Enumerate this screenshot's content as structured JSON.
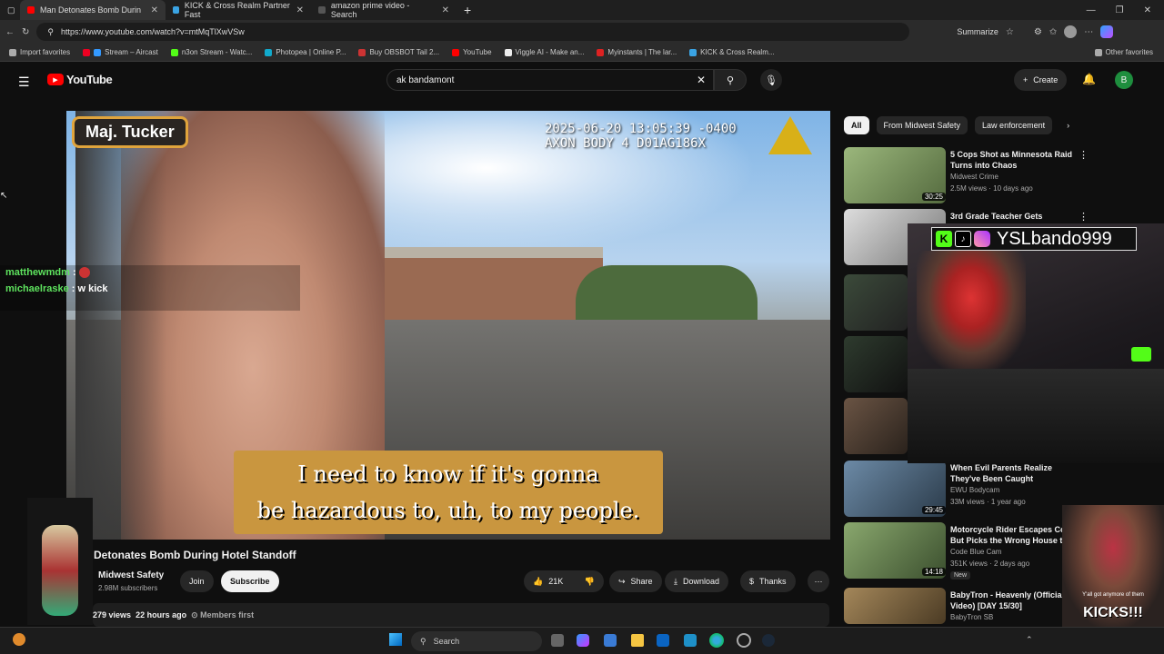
{
  "browser": {
    "tabs": [
      {
        "label": "Man Detonates Bomb Durin",
        "active": true
      },
      {
        "label": "KICK & Cross Realm Partner Fast",
        "active": false
      },
      {
        "label": "amazon prime video - Search",
        "active": false
      }
    ],
    "url": "https://www.youtube.com/watch?v=mtMqTlXwVSw",
    "summarize": "Summarize",
    "bookmarks": [
      "Import favorites",
      "Stream – Aircast",
      "n3on Stream - Watc...",
      "Photopea | Online P...",
      "Buy OBSBOT Tail 2...",
      "YouTube",
      "Viggle AI - Make an...",
      "Myinstants | The lar...",
      "KICK & Cross Realm..."
    ],
    "other_favorites": "Other favorites"
  },
  "youtube": {
    "logo": "YouTube",
    "search_value": "ak bandamont",
    "create": "Create",
    "avatar_letter": "B"
  },
  "video": {
    "overlay_name": "Maj. Tucker",
    "timestamp_line1": "2025-06-20 13:05:39 -0400",
    "timestamp_line2": "AXON BODY 4 D01AG186X",
    "caption_line1": "I need to know if it's gonna",
    "caption_line2": "be hazardous to, uh, to my people.",
    "title": "Detonates Bomb During Hotel Standoff",
    "channel": "Midwest Safety",
    "subscribers": "2.98M subscribers",
    "join": "Join",
    "subscribe": "Subscribe",
    "likes": "21K",
    "share": "Share",
    "download": "Download",
    "thanks": "Thanks",
    "views": "279 views",
    "age": "22 hours ago",
    "members": "Members first"
  },
  "chat": [
    {
      "user": "matthewmdm",
      "msg": ""
    },
    {
      "user": "michaelraske",
      "msg": "w kick"
    }
  ],
  "stream_overlay": {
    "handle": "YSLbando999",
    "cam_text": "Y'all got anymore of them",
    "kick_text": "KICKS!!!"
  },
  "chips": [
    "All",
    "From Midwest Safety",
    "Law enforcement"
  ],
  "recommendations": [
    {
      "title": "5 Cops Shot as Minnesota Raid Turns into Chaos",
      "channel": "Midwest Crime",
      "meta": "2.5M views · 10 days ago",
      "duration": "30:25",
      "color": "#6f8a55"
    },
    {
      "title": "3rd Grade Teacher Gets",
      "channel": "",
      "meta": "",
      "duration": "",
      "color": "#8a8a8a"
    },
    {
      "title": "",
      "channel": "",
      "meta": "",
      "duration": "",
      "color": "#3b4a3a"
    },
    {
      "title": "",
      "channel": "",
      "meta": "",
      "duration": "",
      "color": "#2e3b2e"
    },
    {
      "title": "",
      "channel": "",
      "meta": "",
      "duration": "",
      "color": "#5a4a3a"
    },
    {
      "title": "When Evil Parents Realize They've Been Caught",
      "channel": "EWU Bodycam",
      "meta": "33M views · 1 year ago",
      "duration": "29:45",
      "color": "#3a5066"
    },
    {
      "title": "Motorcycle Rider Escapes Co But Picks the Wrong House to",
      "channel": "Code Blue Cam",
      "meta": "351K views · 2 days ago",
      "duration": "14:18",
      "color": "#5d7a4e"
    },
    {
      "title": "BabyTron - Heavenly (Official Video) [DAY 15/30]",
      "channel": "BabyTron SB",
      "meta": "",
      "duration": "",
      "color": "#6d5a3a"
    }
  ],
  "rec_badge_new": "New",
  "taskbar": {
    "search": "Search"
  }
}
